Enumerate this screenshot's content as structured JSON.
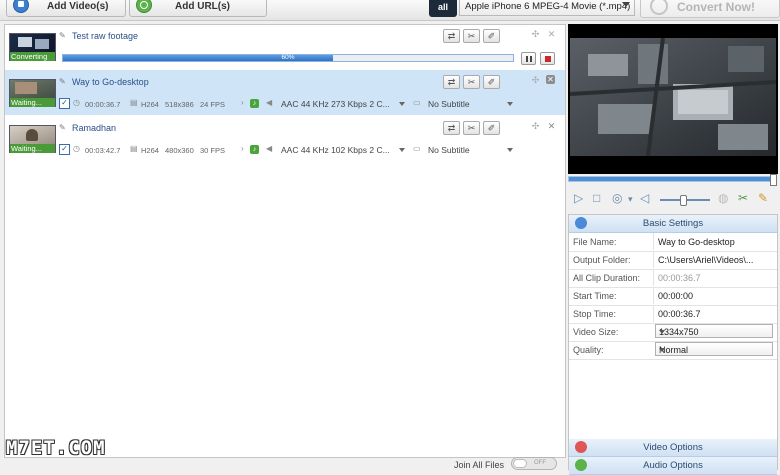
{
  "toolbar": {
    "add_videos_label": "Add Video(s)",
    "add_urls_label": "Add URL(s)",
    "format_icon_text": "all",
    "format_value": "Apple iPhone 6 MPEG-4 Movie (*.mp4)",
    "convert_label": "Convert Now!"
  },
  "files": [
    {
      "name": "Test raw footage",
      "status": "Converting",
      "progress_text": "60%",
      "progress": 0.6
    },
    {
      "name": "Way to Go-desktop",
      "status": "Waiting...",
      "duration": "00:00:36.7",
      "codec": "H264",
      "resolution": "518x386",
      "fps": "24 FPS",
      "audio": "AAC 44 KHz 273 Kbps 2 C...",
      "subtitle": "No Subtitle"
    },
    {
      "name": "Ramadhan",
      "status": "Waiting...",
      "duration": "00:03:42.7",
      "codec": "H264",
      "resolution": "480x360",
      "fps": "30 FPS",
      "audio": "AAC 44 KHz 102 Kbps 2 C...",
      "subtitle": "No Subtitle"
    }
  ],
  "join": {
    "label": "Join All Files",
    "toggle_text": "OFF"
  },
  "watermark": "M7ET.COM",
  "settings": {
    "header": "Basic Settings",
    "rows": [
      {
        "key": "File Name:",
        "value": "Way to Go-desktop"
      },
      {
        "key": "Output Folder:",
        "value": "C:\\Users\\Ariel\\Videos\\..."
      },
      {
        "key": "All Clip Duration:",
        "value": "00:00:36.7"
      },
      {
        "key": "Start Time:",
        "value": "00:00:00"
      },
      {
        "key": "Stop Time:",
        "value": "00:00:36.7"
      },
      {
        "key": "Video Size:",
        "value": "1334x750"
      },
      {
        "key": "Quality:",
        "value": "Normal"
      }
    ],
    "video_options": "Video Options",
    "audio_options": "Audio Options"
  },
  "colors": {
    "accent": "#3a7fd1",
    "selection": "#cfe4f7",
    "converting": "#4b9a3a",
    "video_options_icon": "#e05656",
    "audio_options_icon": "#5cb34a"
  }
}
